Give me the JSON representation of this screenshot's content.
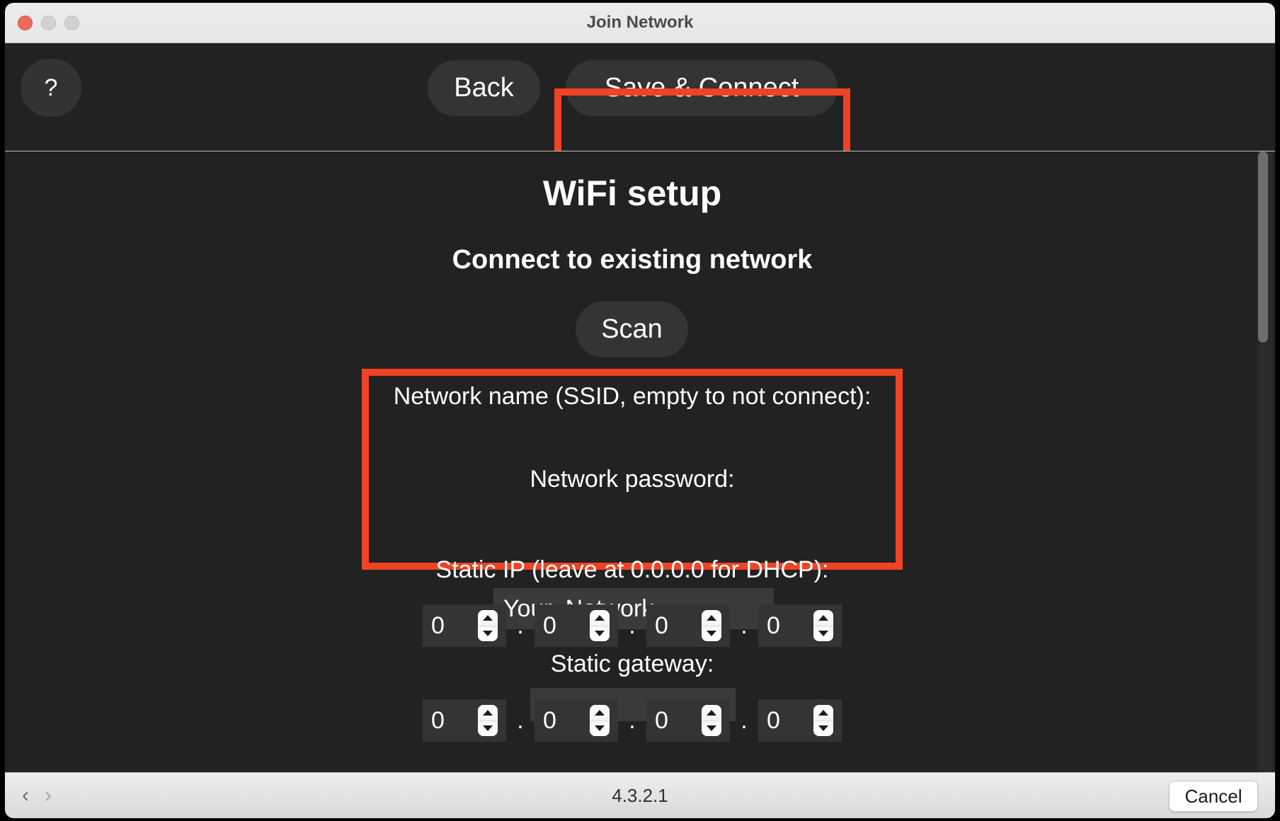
{
  "window": {
    "title": "Join Network",
    "traffic_lights": [
      "close",
      "minimize",
      "maximize"
    ]
  },
  "toolbar": {
    "help_label": "?",
    "back_label": "Back",
    "save_connect_label": "Save & Connect",
    "highlight_color": "#ef4323"
  },
  "main": {
    "heading": "WiFi setup",
    "subheading": "Connect to existing network",
    "scan_label": "Scan",
    "ssid_label": "Network name (SSID, empty to not connect):",
    "ssid_value": "Your_Network",
    "ssid_placeholder": "",
    "password_label": "Network password:",
    "password_value": "",
    "password_placeholder": "",
    "static_ip_label": "Static IP (leave at 0.0.0.0 for DHCP):",
    "static_gateway_label": "Static gateway:",
    "static_ip_octets": [
      "0",
      "0",
      "0",
      "0"
    ],
    "static_gateway_octets": [
      "0",
      "0",
      "0",
      "0"
    ],
    "octet_separator": "."
  },
  "bottombar": {
    "back_arrow": "‹",
    "forward_arrow": "›",
    "version": "4.3.2.1",
    "cancel_label": "Cancel"
  }
}
